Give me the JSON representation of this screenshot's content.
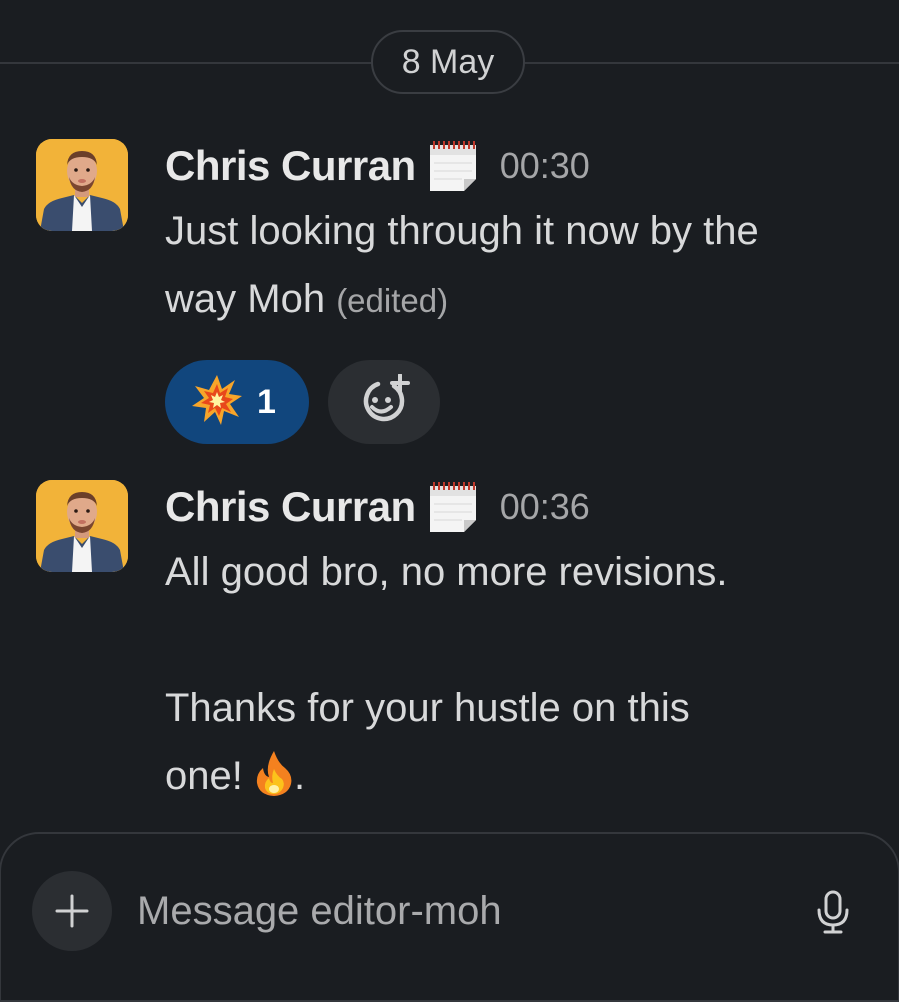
{
  "date_divider": {
    "label": "8 May"
  },
  "messages": [
    {
      "sender": "Chris Curran",
      "status_icon": "calendar-icon",
      "time": "00:30",
      "lines": [
        "Just looking through it now by the",
        "way Moh"
      ],
      "edited_label": "(edited)",
      "reactions": [
        {
          "emoji": "collision-emoji",
          "count": "1"
        }
      ]
    },
    {
      "sender": "Chris Curran",
      "status_icon": "calendar-icon",
      "time": "00:36",
      "lines": [
        "All good bro, no more revisions.",
        "",
        "Thanks for your hustle on this",
        "one!",
        "."
      ],
      "inline_emoji": "fire-emoji"
    }
  ],
  "composer": {
    "placeholder": "Message editor-moh",
    "plus_label": "+"
  },
  "colors": {
    "background": "#1a1d21",
    "reaction_active": "#11467d",
    "avatar_bg": "#f2b339"
  }
}
